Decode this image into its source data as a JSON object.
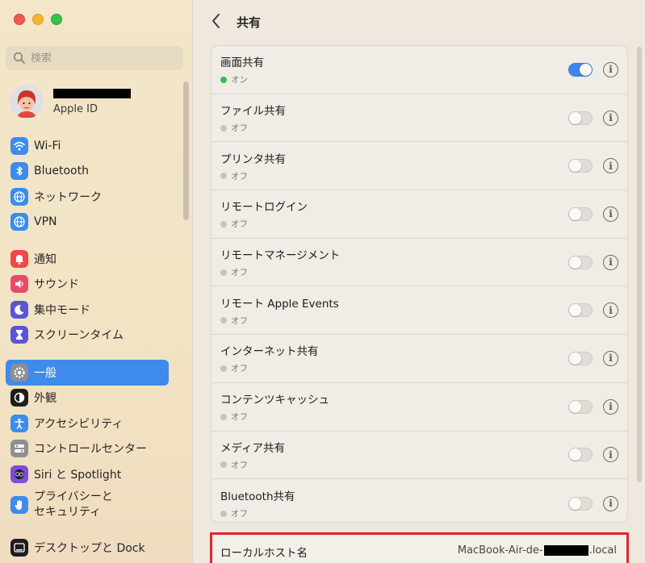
{
  "sidebar": {
    "search_placeholder": "検索",
    "account": {
      "subtitle": "Apple ID"
    },
    "groups": [
      [
        {
          "label": "Wi-Fi",
          "icon": "wifi-icon",
          "color": "#3b8ced"
        },
        {
          "label": "Bluetooth",
          "icon": "bluetooth-icon",
          "color": "#3b8ced"
        },
        {
          "label": "ネットワーク",
          "icon": "globe-icon",
          "color": "#3b8ced"
        },
        {
          "label": "VPN",
          "icon": "vpn-globe-icon",
          "color": "#3b8ced"
        }
      ],
      [
        {
          "label": "通知",
          "icon": "bell-icon",
          "color": "#ef4a45"
        },
        {
          "label": "サウンド",
          "icon": "speaker-icon",
          "color": "#ea4a6a"
        },
        {
          "label": "集中モード",
          "icon": "moon-icon",
          "color": "#5a55d8"
        },
        {
          "label": "スクリーンタイム",
          "icon": "hourglass-icon",
          "color": "#5a55d8"
        }
      ],
      [
        {
          "label": "一般",
          "icon": "gear-icon",
          "color": "#8e8e93",
          "active": true
        },
        {
          "label": "外観",
          "icon": "appearance-icon",
          "color": "#1d1d1d"
        },
        {
          "label": "アクセシビリティ",
          "icon": "accessibility-icon",
          "color": "#3b8ced"
        },
        {
          "label": "コントロールセンター",
          "icon": "control-center-icon",
          "color": "#8e8e93"
        },
        {
          "label": "Siri と Spotlight",
          "icon": "siri-icon",
          "color": "#7a4fd8"
        },
        {
          "label": "プライバシーと\nセキュリティ",
          "icon": "hand-icon",
          "color": "#3b8ced",
          "two_line": true
        }
      ],
      [
        {
          "label": "デスクトップと Dock",
          "icon": "dock-icon",
          "color": "#1d1d1d"
        }
      ]
    ]
  },
  "main": {
    "title": "共有",
    "services": [
      {
        "title": "画面共有",
        "status": "オン",
        "on": true
      },
      {
        "title": "ファイル共有",
        "status": "オフ",
        "on": false
      },
      {
        "title": "プリンタ共有",
        "status": "オフ",
        "on": false
      },
      {
        "title": "リモートログイン",
        "status": "オフ",
        "on": false
      },
      {
        "title": "リモートマネージメント",
        "status": "オフ",
        "on": false
      },
      {
        "title": "リモート Apple Events",
        "status": "オフ",
        "on": false
      },
      {
        "title": "インターネット共有",
        "status": "オフ",
        "on": false
      },
      {
        "title": "コンテンツキャッシュ",
        "status": "オフ",
        "on": false
      },
      {
        "title": "メディア共有",
        "status": "オフ",
        "on": false
      },
      {
        "title": "Bluetooth共有",
        "status": "オフ",
        "on": false
      }
    ],
    "hostname": {
      "label": "ローカルホスト名",
      "value_prefix": "MacBook-Air-de-",
      "value_suffix": ".local"
    }
  }
}
